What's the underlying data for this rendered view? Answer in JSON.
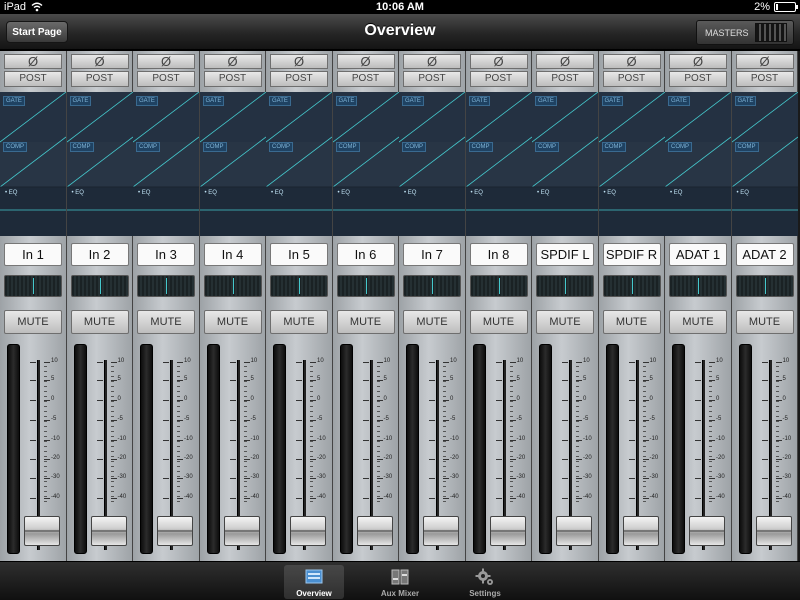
{
  "status": {
    "device": "iPad",
    "time": "10:06 AM",
    "battery": "2%"
  },
  "header": {
    "start_page": "Start Page",
    "title": "Overview",
    "masters": "MASTERS"
  },
  "strip_labels": {
    "phase": "Ø",
    "post": "POST",
    "gate": "GATE",
    "comp": "COMP",
    "eq": "EQ",
    "mute": "MUTE"
  },
  "fader_scale": [
    "10",
    "5",
    "0",
    "-5",
    "-10",
    "-20",
    "-30",
    "-40"
  ],
  "channels": [
    {
      "name": "In 1"
    },
    {
      "name": "In 2"
    },
    {
      "name": "In 3"
    },
    {
      "name": "In 4"
    },
    {
      "name": "In 5"
    },
    {
      "name": "In 6"
    },
    {
      "name": "In 7"
    },
    {
      "name": "In 8"
    },
    {
      "name": "SPDIF L"
    },
    {
      "name": "SPDIF R"
    },
    {
      "name": "ADAT 1"
    },
    {
      "name": "ADAT 2"
    }
  ],
  "tabs": [
    {
      "label": "Overview",
      "icon": "overview-icon",
      "active": true
    },
    {
      "label": "Aux Mixer",
      "icon": "aux-mixer-icon",
      "active": false
    },
    {
      "label": "Settings",
      "icon": "gear-icon",
      "active": false
    }
  ],
  "colors": {
    "accent": "#45c8cc",
    "dynamics_bg": "#2a3544",
    "tag_text": "#7fb3d6"
  }
}
